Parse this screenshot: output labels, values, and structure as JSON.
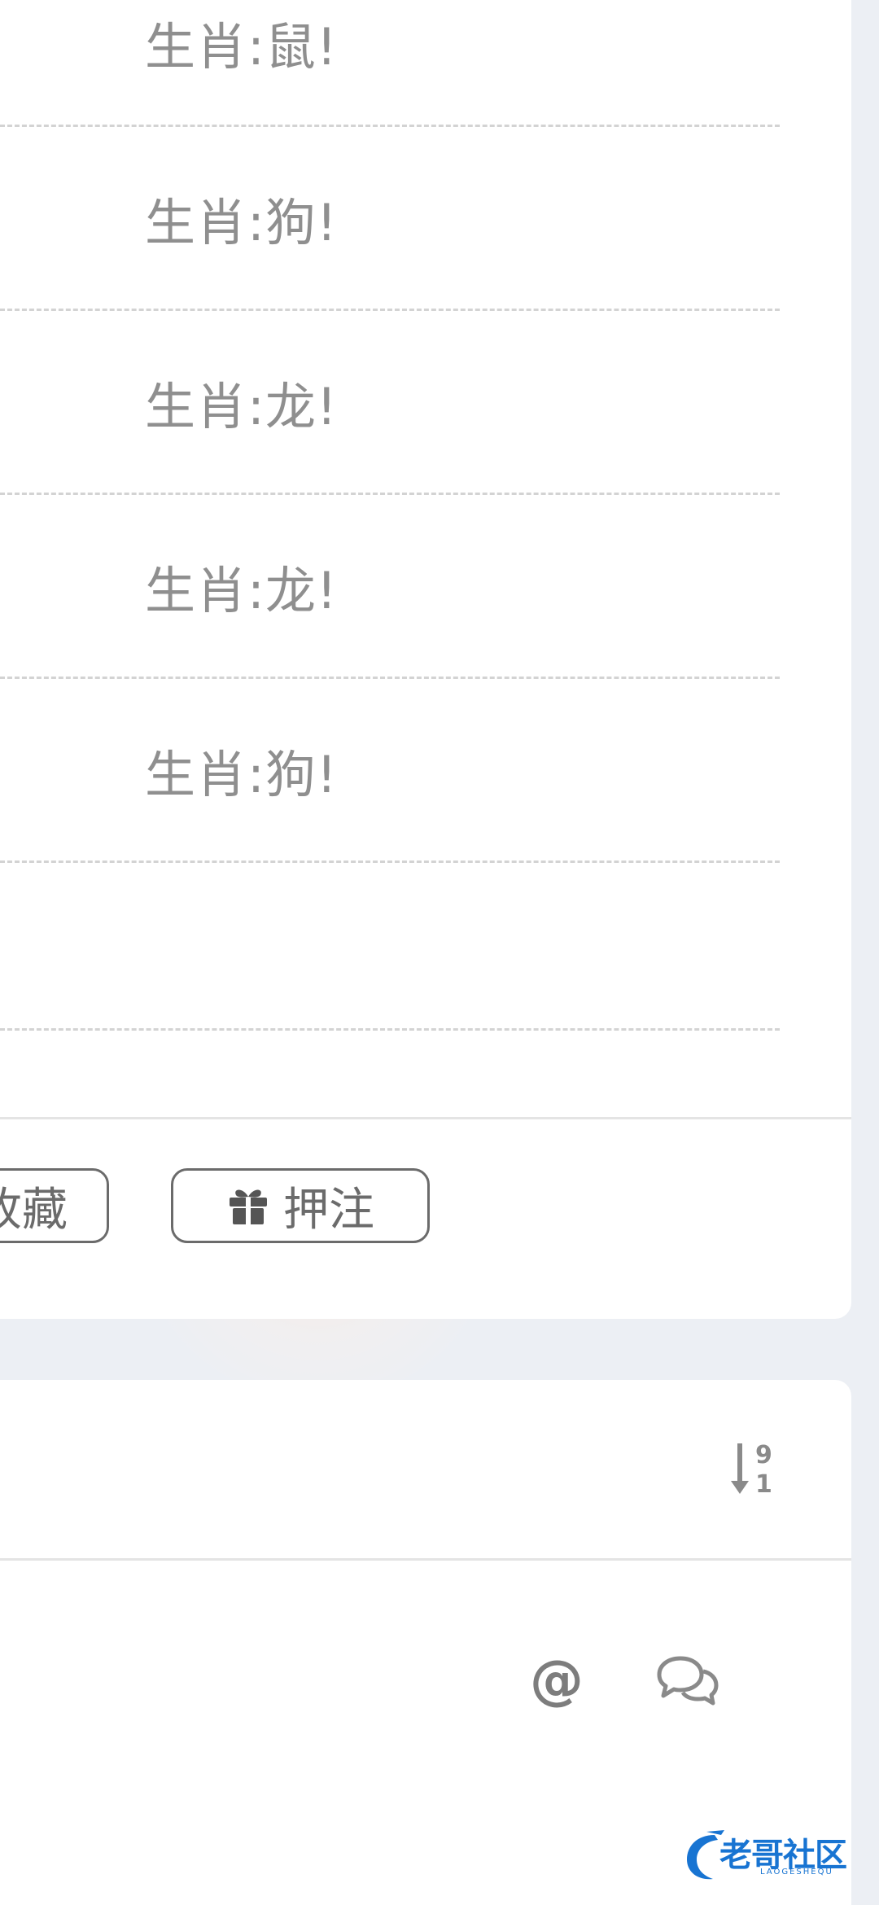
{
  "post": {
    "zodiac_results": [
      "生肖:鼠!",
      "生肖:狗!",
      "生肖:龙!",
      "生肖:龙!",
      "生肖:狗!",
      ""
    ]
  },
  "actions": {
    "favorite_label": "收藏",
    "bet_label": "押注",
    "bet_icon": "gift-icon"
  },
  "comments": {
    "sort_icon": "sort-numeric-desc-icon",
    "mention_icon": "at-icon",
    "comment_icon": "chat-bubbles-icon"
  },
  "branding": {
    "logo_name": "老哥社区",
    "logo_sub": "LAOGESHEQU"
  },
  "colors": {
    "background": "#eceff4",
    "card": "#ffffff",
    "text_muted": "#8f8f8f",
    "button_border": "#6b6b6b",
    "logo_blue": "#1874d2"
  }
}
